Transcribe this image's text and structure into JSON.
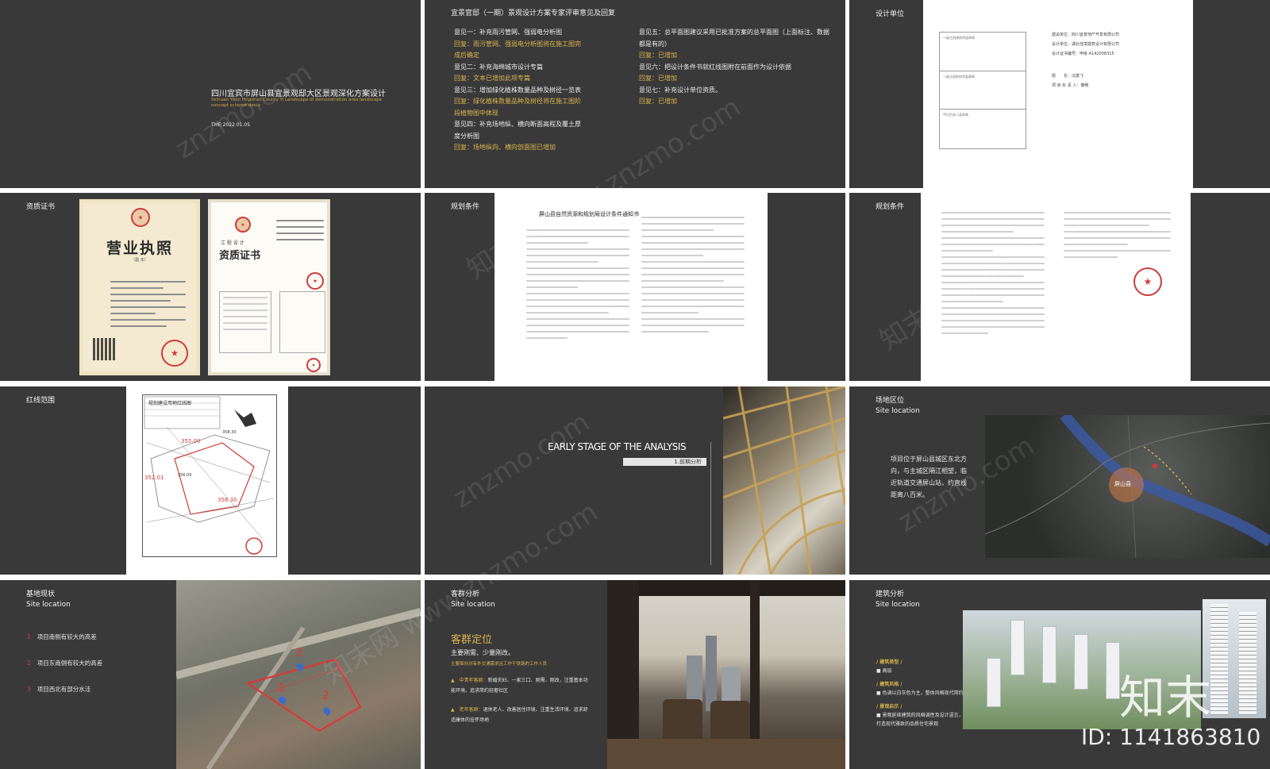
{
  "slide1": {
    "title_cn": "四川宜宾市屏山县宜景观邸大区景观深化方案设计",
    "title_en_1": "Sichuan Yibin Pingshan County Yi Landscape di demonstration area landscape",
    "title_en_2": "concept scheme desig",
    "time": "TME:2022.01.05"
  },
  "slide2": {
    "heading": "宜景官邸（一期）景观设计方案专家评审意见及回复",
    "left_col": [
      {
        "text": "意见一：补充雨污管网、强弱电分析图",
        "gold": false
      },
      {
        "text": "回复：雨污管网、强弱电分析图将在施工图完",
        "gold": true
      },
      {
        "text": "成后确定",
        "gold": true
      },
      {
        "text": "意见二：补充海绵城市设计专篇",
        "gold": false
      },
      {
        "text": "回复：文本已增加此项专篇",
        "gold": true
      },
      {
        "text": "意见三：增加绿化植株数量品种及树径一览表",
        "gold": false
      },
      {
        "text": "回复：绿化植株数量品种及树径将在施工图阶",
        "gold": true
      },
      {
        "text": "段植物图中体现",
        "gold": true
      },
      {
        "text": "意见四：补充场地纵、横向断面高程及覆土厚",
        "gold": false
      },
      {
        "text": "度分析图",
        "gold": false
      },
      {
        "text": "回复：场地纵向、横向剖面图已增加",
        "gold": true
      }
    ],
    "right_col": [
      {
        "text": "意见五：总平面图建议采用已批准方案的总平面图（上面标注、数据",
        "gold": false
      },
      {
        "text": "都是有的）",
        "gold": false
      },
      {
        "text": "回复：已增加",
        "gold": true
      },
      {
        "text": "意见六：把设计条件书就红线图附在前面作为设计依据",
        "gold": false
      },
      {
        "text": "回复：已增加",
        "gold": true
      },
      {
        "text": "意见七：补充设计单位资质。",
        "gold": false
      },
      {
        "text": "回复：已增加",
        "gold": true
      }
    ]
  },
  "slide3": {
    "heading": "设计单位",
    "box_labels": [
      "一级注册建筑师盖章章",
      "一级注册结构师盖章章",
      "甲目负责人盖章章"
    ],
    "info": [
      "建设单位：四川宜景地产开发有限公司",
      "设计单位：湖北佳境建筑设计有限公司",
      "设计证书编号：甲级 A142008315",
      "院　　长：冯富飞",
      "项 目 负 责 人：秦畅"
    ]
  },
  "slide4": {
    "heading": "资质证书",
    "license_title": "营业执照",
    "license_sub": "（副 本）",
    "cert_small": "工 程 设 计",
    "cert_title": "资质证书"
  },
  "slide5": {
    "heading": "规划条件",
    "doc_title": "屏山县自然资源和规划局设计条件通知书"
  },
  "slide6": {
    "heading": "规划条件"
  },
  "slide7": {
    "heading": "红线范围",
    "doc_title": "规划建设用地红线图",
    "elevations": [
      "355.00",
      "358.30",
      "352.01",
      "356.00",
      "358.30"
    ]
  },
  "slide8": {
    "title": "EARLY STAGE OF THE ANALYSIS",
    "tag": "1.前期分析"
  },
  "slide9": {
    "heading_cn": "场地区位",
    "heading_en": "Site location",
    "desc": "项目位于屏山县城区东北方向，与主城区隔江相望，临近轨道交通屏山站，约直线距离八百米。",
    "map_label": "屏山县"
  },
  "slide10": {
    "heading_cn": "基地现状",
    "heading_en": "Site location",
    "items": [
      {
        "num": "1",
        "text": "项目南侧有较大的高差"
      },
      {
        "num": "2",
        "text": "项目东南侧有较大的高差"
      },
      {
        "num": "3",
        "text": "项目西北有部分水洼"
      }
    ],
    "markers": [
      "1",
      "2",
      "3"
    ]
  },
  "slide11": {
    "heading_cn": "客群分析",
    "heading_en": "Site location",
    "title": "客群定位",
    "sub1": "主要刚需、少量刚改。",
    "sub2": "主要面向对有外交通需求且工作于铁路的工作人员",
    "groups": [
      {
        "label": "中青年客群：",
        "text": "新婚夫妇、一家三口、刚需、刚改，注重基本功能环境、追求简约轻奢社区"
      },
      {
        "label": "老年客群：",
        "text": "退休老人、改善居住环境、注重生活环境、追求舒适康体的挂怀场地"
      }
    ]
  },
  "slide12": {
    "heading_cn": "建筑分析",
    "heading_en": "Site location",
    "sections": [
      {
        "title": "/ 建筑类型 /",
        "text": "高层"
      },
      {
        "title": "/ 建筑风格 /",
        "text": "色调以白灰色为主，整体风格现代简约"
      },
      {
        "title": "/ 景观启示 /",
        "text": "景观延续建筑的风格调性及设计语言，打造现代雅致的品质住宅景观"
      }
    ]
  },
  "watermark": {
    "text1": "znzmo.com",
    "text2": "知末网 www.znzmo.com",
    "logo": "知末",
    "id": "ID: 1141863810"
  },
  "colors": {
    "slide_bg": "#3a3939",
    "gold": "#d8b54e",
    "red": "#d23b3b"
  }
}
